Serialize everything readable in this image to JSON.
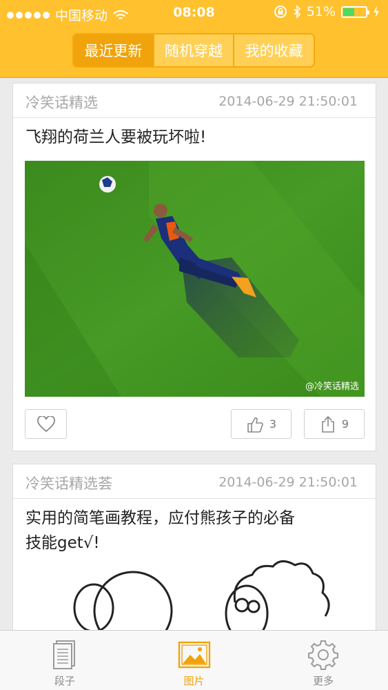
{
  "status_bar": {
    "carrier": "中国移动",
    "time": "08:08",
    "battery": "51%",
    "battery_level": 0.51
  },
  "segments": [
    {
      "label": "最近更新",
      "active": true
    },
    {
      "label": "随机穿越",
      "active": false
    },
    {
      "label": "我的收藏",
      "active": false
    }
  ],
  "posts": [
    {
      "source": "冷笑话精选",
      "date": "2014-06-29 21:50:01",
      "title": "飞翔的荷兰人要被玩坏啦!",
      "image_watermark": "@冷笑话精选",
      "likes": "3",
      "shares": "9"
    },
    {
      "source": "冷笑话精选荟",
      "date": "2014-06-29 21:50:01",
      "title_line1": "实用的简笔画教程，应付熊孩子的必备",
      "title_line2": "技能get√!"
    }
  ],
  "tabs": [
    {
      "label": "段子",
      "icon": "document-icon",
      "active": false
    },
    {
      "label": "图片",
      "icon": "picture-icon",
      "active": true
    },
    {
      "label": "更多",
      "icon": "gear-icon",
      "active": false
    }
  ],
  "colors": {
    "header": "#ffc12e",
    "accent": "#f0a30a",
    "battery": "#4cd964"
  }
}
